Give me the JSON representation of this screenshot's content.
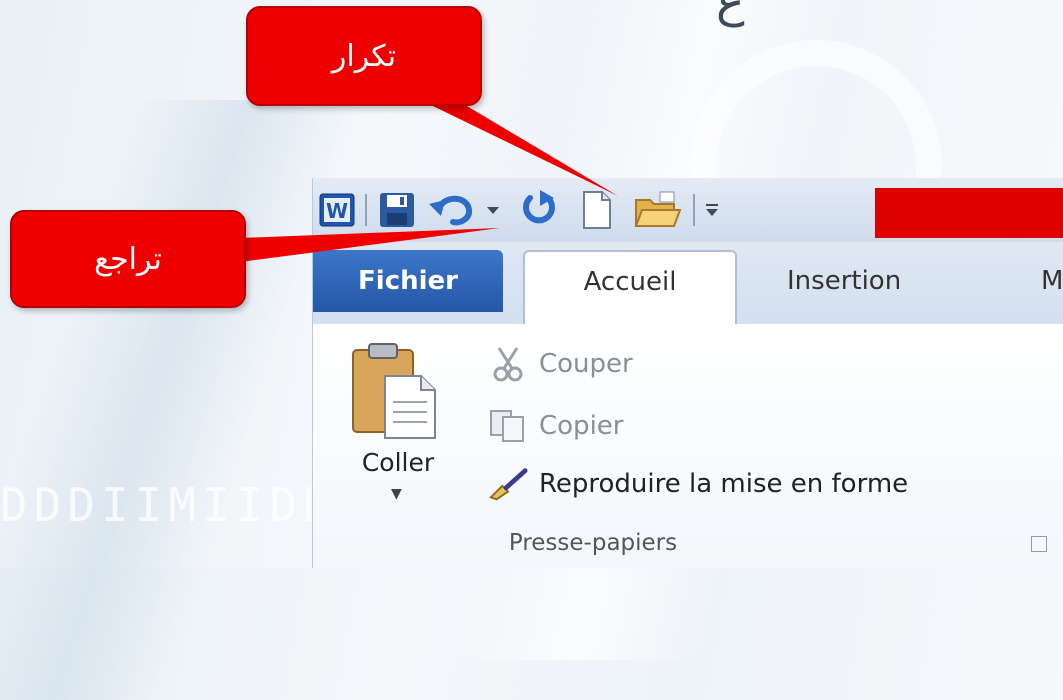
{
  "background": {
    "watermark": "DDDIIMIIDD",
    "top_glyph": "ع"
  },
  "quick_access": {
    "icons": [
      "word-logo-icon",
      "save-icon",
      "undo-icon",
      "undo-dropdown-icon",
      "redo-icon",
      "new-document-icon",
      "open-folder-icon",
      "customize-qat-icon"
    ]
  },
  "tabs": {
    "file": "Fichier",
    "home": "Accueil",
    "insert": "Insertion",
    "cut_off": "M"
  },
  "ribbon": {
    "paste": "Coller",
    "cut": "Couper",
    "copy": "Copier",
    "format_painter": "Reproduire la mise en forme",
    "group_label": "Presse-papiers"
  },
  "callouts": {
    "redo": "تكرار",
    "undo": "تراجع"
  },
  "colors": {
    "callout_red": "#ee0000",
    "file_tab_blue": "#2f68b8",
    "undo_blue": "#2d6cc8"
  }
}
